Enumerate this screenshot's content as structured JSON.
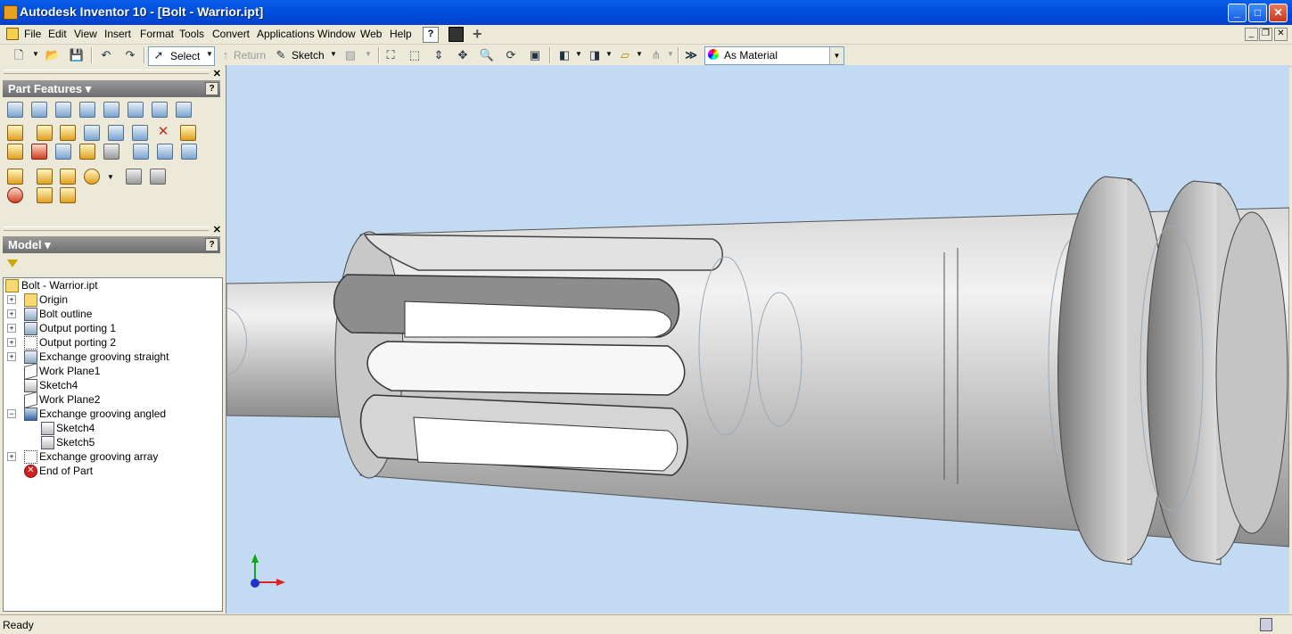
{
  "window": {
    "title": "Autodesk Inventor 10 - [Bolt - Warrior.ipt]"
  },
  "menu": {
    "items": [
      "File",
      "Edit",
      "View",
      "Insert",
      "Format",
      "Tools",
      "Convert",
      "Applications",
      "Window",
      "Web",
      "Help"
    ]
  },
  "toolbar": {
    "select_label": "Select",
    "return_label": "Return",
    "sketch_label": "Sketch",
    "appearance": {
      "value": "As Material"
    }
  },
  "part_features": {
    "title": "Part Features",
    "help": "?"
  },
  "model": {
    "title": "Model",
    "help": "?",
    "tree": [
      {
        "label": "Bolt - Warrior.ipt",
        "icon": "part-icon",
        "level": 0,
        "expander": ""
      },
      {
        "label": "Origin",
        "icon": "folder-icon",
        "level": 1,
        "expander": "+"
      },
      {
        "label": "Bolt outline",
        "icon": "revolve-icon",
        "level": 1,
        "expander": "+"
      },
      {
        "label": "Output porting 1",
        "icon": "extrude-icon",
        "level": 1,
        "expander": "+"
      },
      {
        "label": "Output porting 2",
        "icon": "pattern-icon",
        "level": 1,
        "expander": "+"
      },
      {
        "label": "Exchange grooving straight",
        "icon": "extrude-icon",
        "level": 1,
        "expander": "+"
      },
      {
        "label": "Work Plane1",
        "icon": "work-plane-icon",
        "level": 1,
        "expander": ""
      },
      {
        "label": "Sketch4",
        "icon": "sketch-icon",
        "level": 1,
        "expander": ""
      },
      {
        "label": "Work Plane2",
        "icon": "work-plane-icon",
        "level": 1,
        "expander": ""
      },
      {
        "label": "Exchange grooving angled",
        "icon": "sweep-icon",
        "level": 1,
        "expander": "-"
      },
      {
        "label": "Sketch4",
        "icon": "sketch-icon",
        "level": 2,
        "expander": ""
      },
      {
        "label": "Sketch5",
        "icon": "sketch-icon",
        "level": 2,
        "expander": ""
      },
      {
        "label": "Exchange grooving array",
        "icon": "pattern-icon",
        "level": 1,
        "expander": "+"
      },
      {
        "label": "End of Part",
        "icon": "end-of-part-icon",
        "level": 1,
        "expander": ""
      }
    ]
  },
  "status": {
    "text": "Ready"
  },
  "colors": {
    "titlebar": "#0050e0",
    "viewport_bg": "#c3dbf2",
    "panel_header": "#7d7d7d"
  }
}
